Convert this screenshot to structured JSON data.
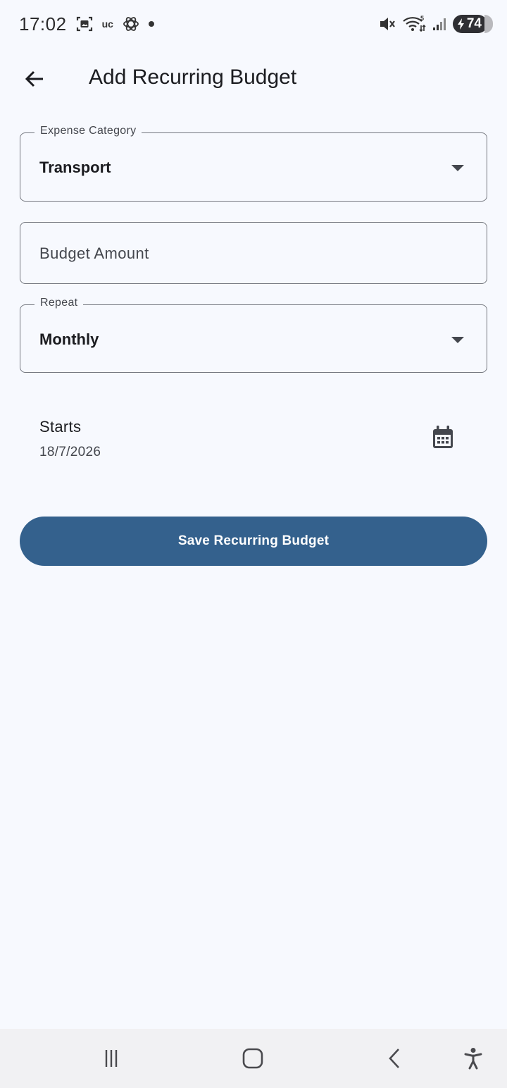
{
  "status_bar": {
    "time": "17:02",
    "carrier_text": "uc",
    "battery_level": "74",
    "icons": [
      "screenshot-icon",
      "uc-browser-icon",
      "chatgpt-icon",
      "notification-dot",
      "mute-icon",
      "wifi-icon",
      "signal-icon",
      "battery-charging-icon"
    ]
  },
  "app_bar": {
    "title": "Add Recurring Budget",
    "back_icon": "arrow-back-icon"
  },
  "form": {
    "category": {
      "label": "Expense Category",
      "value": "Transport"
    },
    "amount": {
      "placeholder": "Budget Amount",
      "value": ""
    },
    "repeat": {
      "label": "Repeat",
      "value": "Monthly"
    },
    "starts": {
      "label": "Starts",
      "date": "18/7/2026",
      "icon": "calendar-icon"
    },
    "save_label": "Save Recurring Budget"
  },
  "nav_bar": {
    "icons": [
      "recent-apps-icon",
      "home-icon",
      "back-icon",
      "accessibility-icon"
    ]
  },
  "colors": {
    "background": "#f7f9fe",
    "primary": "#34618d",
    "outline": "#74777f",
    "nav_background": "#f1f1f3"
  }
}
